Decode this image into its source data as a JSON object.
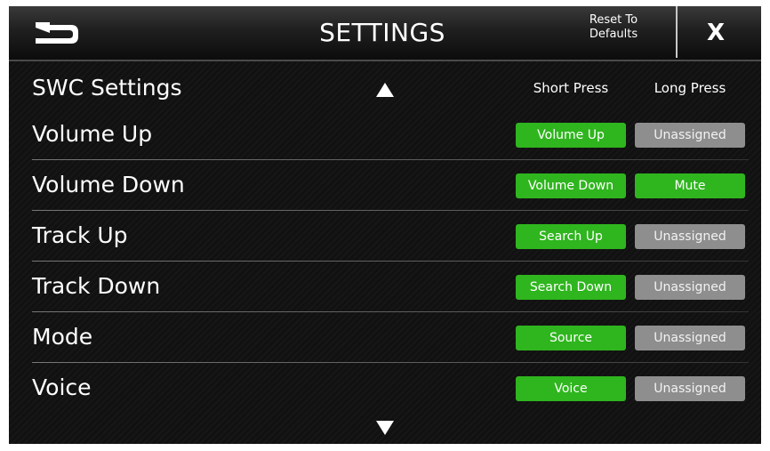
{
  "header": {
    "title": "SETTINGS",
    "reset_line1": "Reset To",
    "reset_line2": "Defaults",
    "close_label": "X"
  },
  "section": {
    "title": "SWC Settings",
    "short_press_label": "Short Press",
    "long_press_label": "Long Press"
  },
  "rows": [
    {
      "label": "Volume Up",
      "short": "Volume Up",
      "long": "Unassigned"
    },
    {
      "label": "Volume Down",
      "short": "Volume Down",
      "long": "Mute"
    },
    {
      "label": "Track Up",
      "short": "Search Up",
      "long": "Unassigned"
    },
    {
      "label": "Track Down",
      "short": "Search Down",
      "long": "Unassigned"
    },
    {
      "label": "Mode",
      "short": "Source",
      "long": "Unassigned"
    },
    {
      "label": "Voice",
      "short": "Voice",
      "long": "Unassigned"
    }
  ],
  "icons": {
    "back": "back-arrow-icon",
    "scroll_up": "triangle-up-icon",
    "scroll_down": "triangle-down-icon"
  },
  "colors": {
    "assigned": "#2fb51e",
    "unassigned": "#8e8e8e",
    "background": "#0b0b0b"
  }
}
